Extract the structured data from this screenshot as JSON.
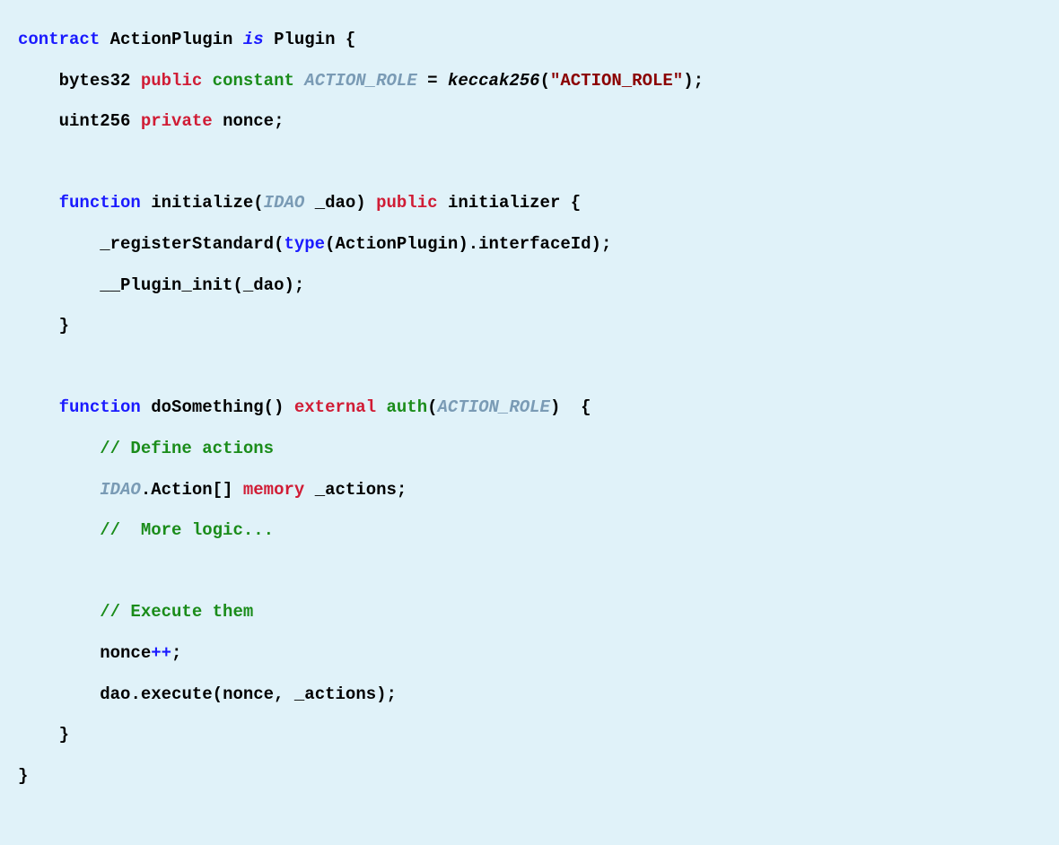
{
  "code": {
    "line1": {
      "contract": "contract",
      "name": "ActionPlugin",
      "is": "is",
      "parent": "Plugin",
      "brace": "{"
    },
    "line2": {
      "type": "bytes32",
      "vis": "public",
      "mod": "constant",
      "name": "ACTION_ROLE",
      "eq": "=",
      "fn": "keccak256",
      "lparen": "(",
      "str": "\"ACTION_ROLE\"",
      "rparen": ")",
      "semi": ";"
    },
    "line3": {
      "type": "uint256",
      "vis": "private",
      "name": "nonce",
      "semi": ";"
    },
    "line5": {
      "fn": "function",
      "name": "initialize",
      "lparen": "(",
      "ptype": "IDAO",
      "pname": "_dao",
      "rparen": ")",
      "vis": "public",
      "mod": "initializer",
      "brace": "{"
    },
    "line6": {
      "fn": "_registerStandard",
      "lparen": "(",
      "type_kw": "type",
      "lparen2": "(",
      "tname": "ActionPlugin",
      "rparen2": ")",
      "dot": ".",
      "prop": "interfaceId",
      "rparen": ")",
      "semi": ";"
    },
    "line7": {
      "fn": "__Plugin_init",
      "lparen": "(",
      "arg": "_dao",
      "rparen": ")",
      "semi": ";"
    },
    "line8": {
      "brace": "}"
    },
    "line10": {
      "fn": "function",
      "name": "doSomething",
      "parens": "()",
      "vis": "external",
      "auth": "auth",
      "lparen": "(",
      "role": "ACTION_ROLE",
      "rparen": ")",
      "brace": "{"
    },
    "line11": {
      "comment": "// Define actions"
    },
    "line12": {
      "type": "IDAO",
      "dot": ".",
      "sub": "Action",
      "brackets": "[]",
      "mem": "memory",
      "name": "_actions",
      "semi": ";"
    },
    "line13": {
      "comment": "//  More logic..."
    },
    "line15": {
      "comment": "// Execute them"
    },
    "line16": {
      "name": "nonce",
      "op": "++",
      "semi": ";"
    },
    "line17": {
      "obj": "dao",
      "dot": ".",
      "fn": "execute",
      "lparen": "(",
      "arg1": "nonce",
      "comma": ",",
      "arg2": "_actions",
      "rparen": ")",
      "semi": ";"
    },
    "line18": {
      "brace": "}"
    },
    "line19": {
      "brace": "}"
    }
  }
}
